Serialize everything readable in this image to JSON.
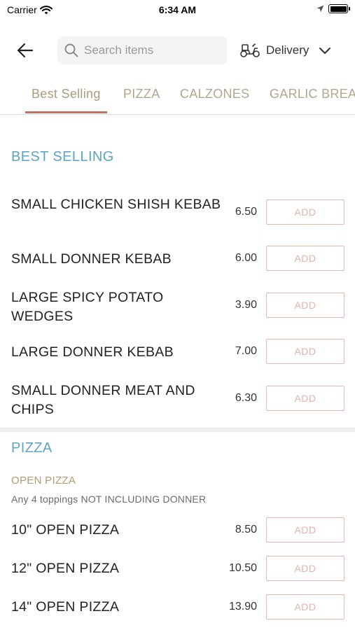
{
  "status_bar": {
    "carrier": "Carrier",
    "time": "6:34 AM"
  },
  "header": {
    "search_placeholder": "Search items",
    "delivery_label": "Delivery"
  },
  "tabs": [
    "Best Selling",
    "PIZZA",
    "CALZONES",
    "GARLIC BREAD"
  ],
  "sections": {
    "best_selling": {
      "title": "BEST SELLING",
      "items": [
        {
          "name": "SMALL CHICKEN SHISH KEBAB",
          "price": "6.50",
          "button": "ADD"
        },
        {
          "name": "SMALL DONNER KEBAB",
          "price": "6.00",
          "button": "ADD"
        },
        {
          "name": "LARGE SPICY POTATO WEDGES",
          "price": "3.90",
          "button": "ADD"
        },
        {
          "name": "LARGE DONNER KEBAB",
          "price": "7.00",
          "button": "ADD"
        },
        {
          "name": "SMALL DONNER MEAT AND CHIPS",
          "price": "6.30",
          "button": "ADD"
        }
      ]
    },
    "pizza": {
      "title": "PIZZA",
      "subsection_title": "OPEN PIZZA",
      "subsection_desc": "Any 4 toppings NOT INCLUDING DONNER",
      "items": [
        {
          "name": "10\" OPEN PIZZA",
          "price": "8.50",
          "button": "ADD"
        },
        {
          "name": "12\" OPEN PIZZA",
          "price": "10.50",
          "button": "ADD"
        },
        {
          "name": "14\" OPEN PIZZA",
          "price": "13.90",
          "button": "ADD"
        }
      ]
    }
  },
  "colors": {
    "accent_blue": "#5aa6c4",
    "tab_gold": "#a99d7e",
    "underline": "#c0725f",
    "add_border": "#e7b8ad"
  },
  "icons": [
    "wifi-icon",
    "location-arrow-icon",
    "battery-icon",
    "back-arrow-icon",
    "search-icon",
    "scooter-icon",
    "chevron-down-icon"
  ]
}
